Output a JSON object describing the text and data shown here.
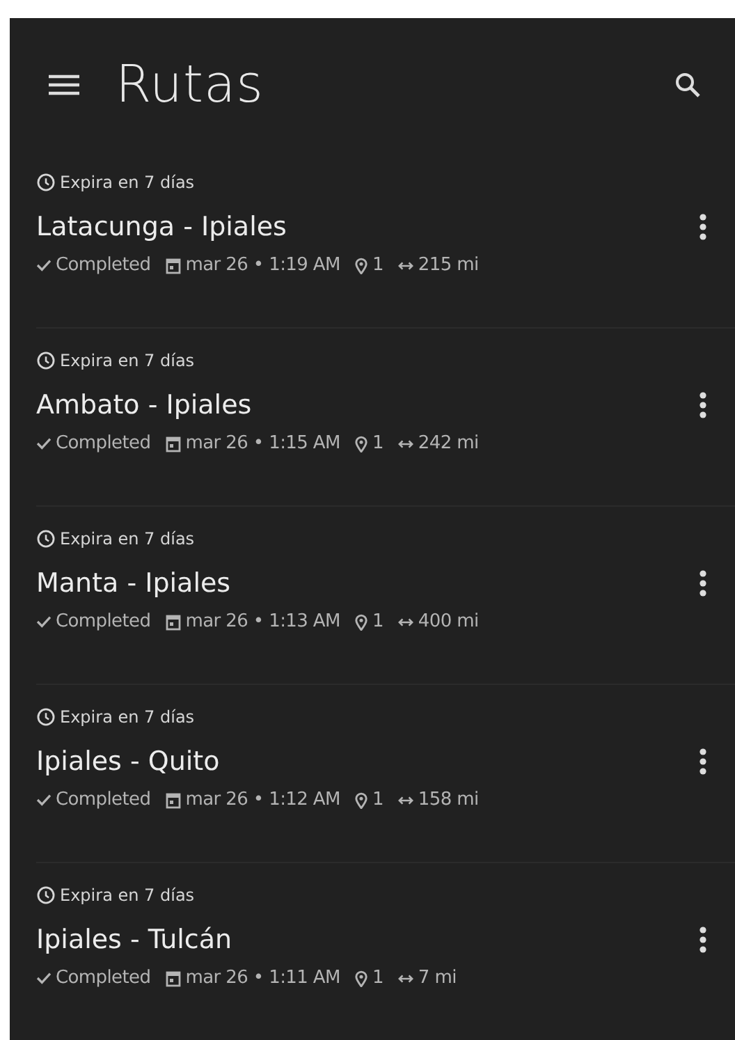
{
  "header": {
    "title": "Rutas"
  },
  "routes": [
    {
      "expiry": "Expira en 7 días",
      "name": "Latacunga - Ipiales",
      "status": "Completed",
      "date": "mar 26 • 1:19 AM",
      "stops": "1",
      "distance": "215 mi"
    },
    {
      "expiry": "Expira en 7 días",
      "name": "Ambato - Ipiales",
      "status": "Completed",
      "date": "mar 26 • 1:15 AM",
      "stops": "1",
      "distance": "242 mi"
    },
    {
      "expiry": "Expira en 7 días",
      "name": "Manta - Ipiales",
      "status": "Completed",
      "date": "mar 26 • 1:13 AM",
      "stops": "1",
      "distance": "400 mi"
    },
    {
      "expiry": "Expira en 7 días",
      "name": "Ipiales - Quito",
      "status": "Completed",
      "date": "mar 26 • 1:12 AM",
      "stops": "1",
      "distance": "158 mi"
    },
    {
      "expiry": "Expira en 7 días",
      "name": "Ipiales - Tulcán",
      "status": "Completed",
      "date": "mar 26 • 1:11 AM",
      "stops": "1",
      "distance": "7 mi"
    }
  ]
}
